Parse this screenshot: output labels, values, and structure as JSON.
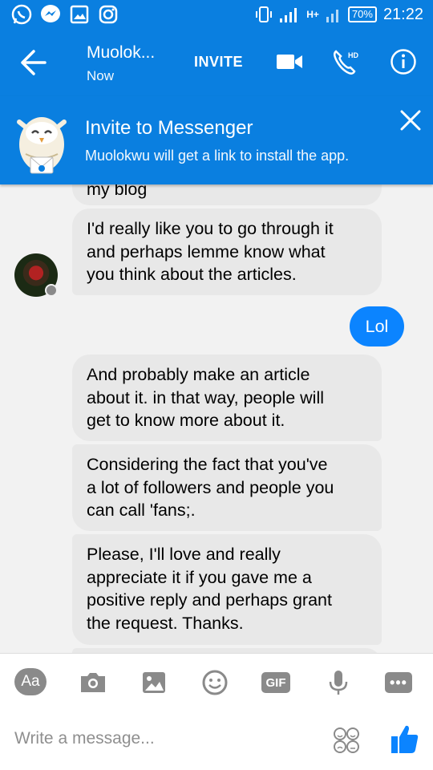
{
  "status_bar": {
    "network_label": "H+",
    "battery": "70%",
    "time": "21:22"
  },
  "header": {
    "contact_name": "Muolok...",
    "contact_status": "Now",
    "invite_label": "INVITE",
    "hd_label": "HD"
  },
  "banner": {
    "title": "Invite to Messenger",
    "subtitle": "Muolokwu will get a link to install the app."
  },
  "messages": [
    {
      "from": "them",
      "text": "my blog"
    },
    {
      "from": "them",
      "lines": [
        "I'd really like you to go through it",
        "and perhaps lemme know what",
        "you think about the articles."
      ]
    },
    {
      "from": "me",
      "text": "Lol"
    },
    {
      "from": "them",
      "lines": [
        "And probably make an article",
        "about it. in that way, people will",
        "get to know more about it."
      ]
    },
    {
      "from": "them",
      "lines": [
        "Considering the fact that you've",
        "a lot of followers and people you",
        "can call 'fans;."
      ]
    },
    {
      "from": "them",
      "lines": [
        "Please, I'll love and really",
        "appreciate it if you gave me a",
        "positive reply and perhaps grant",
        "the request. Thanks."
      ]
    }
  ],
  "composer": {
    "aa_label": "Aa",
    "gif_label": "GIF",
    "more_label": "•••",
    "placeholder": "Write a message..."
  },
  "colors": {
    "brand_blue": "#0a7fe0",
    "outgoing_bubble": "#0b84ff",
    "incoming_bubble": "#e8e8e8"
  }
}
